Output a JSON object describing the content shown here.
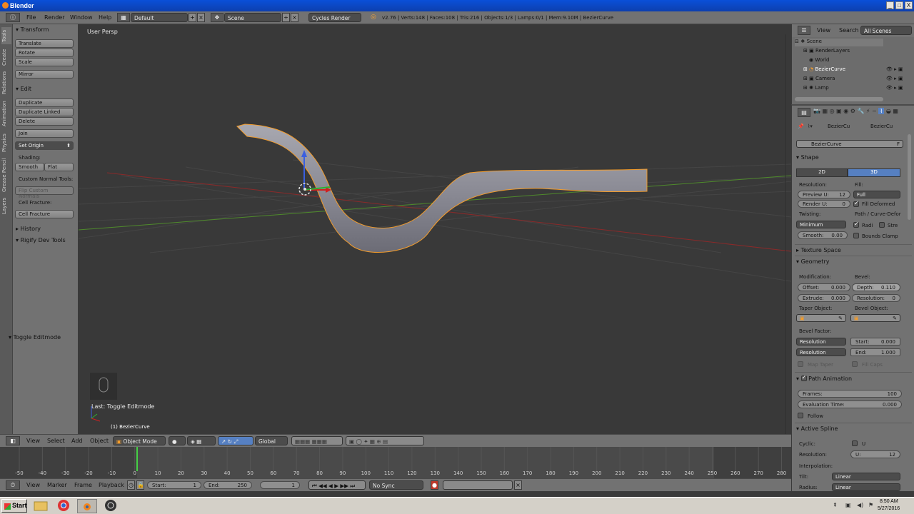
{
  "window": {
    "title": "Blender",
    "min": "_",
    "max": "□",
    "close": "X"
  },
  "main_header": {
    "menus": [
      "File",
      "Render",
      "Window",
      "Help"
    ],
    "layout": "Default",
    "scene": "Scene",
    "engine": "Cycles Render",
    "stats": "v2.76 | Verts:148 | Faces:108 | Tris:216 | Objects:1/3 | Lamps:0/1 | Mem:9.10M | BezierCurve"
  },
  "tabs": [
    "Tools",
    "Create",
    "Relations",
    "Animation",
    "Physics",
    "Grease Pencil",
    "Layers"
  ],
  "tool_shelf": {
    "transform_title": "Transform",
    "transform_buttons": [
      "Translate",
      "Rotate",
      "Scale",
      "Mirror"
    ],
    "edit_title": "Edit",
    "edit_buttons": [
      "Duplicate",
      "Duplicate Linked",
      "Delete",
      "Join"
    ],
    "set_origin": "Set Origin",
    "shading_label": "Shading:",
    "smooth": "Smooth",
    "flat": "Flat",
    "custom_normal_tools": "Custom Normal Tools:",
    "flip_custom_normals": "Flip Custom Normals",
    "cell_fracture_label": "Cell Fracture:",
    "cell_fracture_button": "Cell Fracture",
    "history": "History",
    "rigify": "Rigify Dev Tools",
    "toggle_editmode": "Toggle Editmode"
  },
  "viewport": {
    "label": "User Persp",
    "last_op": "Last: Toggle Editmode",
    "active_object": "(1) BezierCurve"
  },
  "view_header": {
    "menus": [
      "View",
      "Select",
      "Add",
      "Object"
    ],
    "mode": "Object Mode",
    "orientation": "Global"
  },
  "timeline": {
    "ticks": [
      "-50",
      "-40",
      "-30",
      "-20",
      "-10",
      "0",
      "10",
      "20",
      "30",
      "40",
      "50",
      "60",
      "70",
      "80",
      "90",
      "100",
      "110",
      "120",
      "130",
      "140",
      "150",
      "160",
      "170",
      "180",
      "190",
      "200",
      "210",
      "220",
      "230",
      "240",
      "250",
      "260",
      "270",
      "280"
    ],
    "menus": [
      "View",
      "Marker",
      "Frame",
      "Playback"
    ],
    "start_label": "Start:",
    "start": "1",
    "end_label": "End:",
    "end": "250",
    "current": "1",
    "sync": "No Sync"
  },
  "outliner": {
    "menus": [
      "View",
      "Search"
    ],
    "filter": "All Scenes",
    "items": [
      "Scene",
      "RenderLayers",
      "World",
      "BezierCurve",
      "Camera",
      "Lamp"
    ]
  },
  "properties": {
    "breadcrumb": [
      "BezierCu",
      "BezierCu"
    ],
    "datablock": "BezierCurve",
    "datablock_users": "F",
    "shape": {
      "title": "Shape",
      "tab_2d": "2D",
      "tab_3d": "3D",
      "resolution_label": "Resolution:",
      "preview_u": "Preview U:",
      "preview_u_val": "12",
      "render_u": "Render U:",
      "render_u_val": "0",
      "fill_label": "Fill:",
      "fill": "Full",
      "fill_deformed": "Fill Deformed",
      "twisting_label": "Twisting:",
      "twisting": "Minimum",
      "path_curve_deform": "Path / Curve-Defor",
      "radius": "Radi",
      "stretch": "Stre",
      "smooth": "Smooth:",
      "smooth_val": "0.00",
      "bounds_clamp": "Bounds Clamp"
    },
    "texture_space": "Texture Space",
    "geometry": {
      "title": "Geometry",
      "modification": "Modification:",
      "bevel": "Bevel:",
      "offset": "Offset:",
      "offset_val": "0.000",
      "depth": "Depth:",
      "depth_val": "0.110",
      "extrude": "Extrude:",
      "extrude_val": "0.000",
      "resolution": "Resolution:",
      "resolution_val": "0",
      "taper_object": "Taper Object:",
      "bevel_object": "Bevel Object:",
      "bevel_factor": "Bevel Factor:",
      "res_mode_1": "Resolution",
      "start": "Start:",
      "start_val": "0.000",
      "res_mode_2": "Resolution",
      "end": "End:",
      "end_val": "1.000",
      "map_taper": "Map Taper",
      "fill_caps": "Fill Caps"
    },
    "path_animation": {
      "title": "Path Animation",
      "frames": "Frames:",
      "frames_val": "100",
      "eval_time": "Evaluation Time:",
      "eval_time_val": "0.000",
      "follow": "Follow"
    },
    "active_spline": {
      "title": "Active Spline",
      "cyclic": "Cyclic:",
      "u": "U",
      "resolution": "Resolution:",
      "res_u": "U:",
      "res_u_val": "12",
      "interpolation": "Interpolation:",
      "tilt": "Tilt:",
      "tilt_val": "Linear",
      "radius": "Radius:",
      "radius_val": "Linear"
    }
  },
  "taskbar": {
    "start": "Start",
    "time": "8:50 AM",
    "date": "5/27/2016"
  },
  "colors": {
    "accent": "#5680c2",
    "selection": "#f39c2b",
    "x_axis": "#8a2a2a",
    "y_axis": "#4f8a2c"
  }
}
